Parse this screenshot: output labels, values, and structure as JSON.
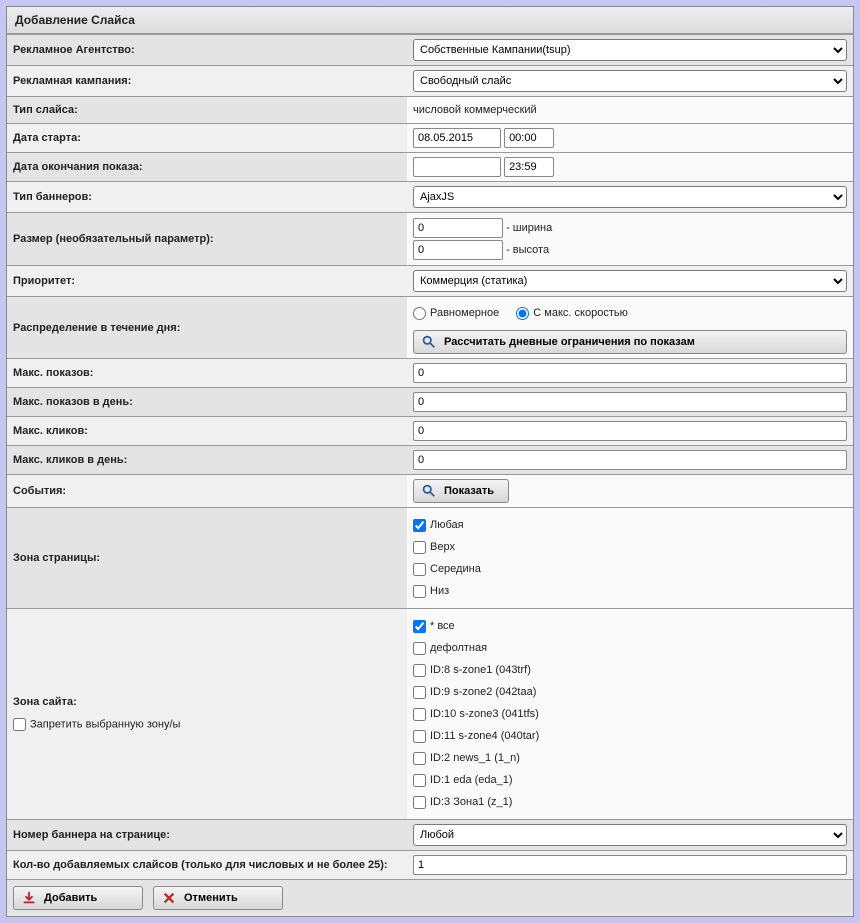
{
  "title": "Добавление Слайса",
  "rows": {
    "agency": {
      "label": "Рекламное Агентство:",
      "value": "Собственные Кампании(tsup)"
    },
    "campaign": {
      "label": "Рекламная кампания:",
      "value": "Свободный слайс"
    },
    "sliceType": {
      "label": "Тип слайса:",
      "value": "числовой коммерческий"
    },
    "startDate": {
      "label": "Дата старта:",
      "date": "08.05.2015",
      "time": "00:00"
    },
    "endDate": {
      "label": "Дата окончания показа:",
      "date": "",
      "time": "23:59"
    },
    "bannerType": {
      "label": "Тип баннеров:",
      "value": "AjaxJS"
    },
    "size": {
      "label": "Размер (необязательный параметр):",
      "width": "0",
      "widthLabel": " - ширина",
      "height": "0",
      "heightLabel": " - высота"
    },
    "priority": {
      "label": "Приоритет:",
      "value": "Коммерция (статика)"
    },
    "distribution": {
      "label": "Распределение в течение дня:",
      "opt1": "Равномерное",
      "opt2": "С макс. скоростью",
      "calcBtn": "Рассчитать дневные ограничения по показам"
    },
    "maxImp": {
      "label": "Макс. показов:",
      "value": "0"
    },
    "maxImpDay": {
      "label": "Макс. показов в день:",
      "value": "0"
    },
    "maxClk": {
      "label": "Макс. кликов:",
      "value": "0"
    },
    "maxClkDay": {
      "label": "Макс. кликов в день:",
      "value": "0"
    },
    "events": {
      "label": "События:",
      "btn": "Показать"
    },
    "pageZone": {
      "label": "Зона страницы:",
      "opts": [
        "Любая",
        "Верх",
        "Середина",
        "Низ"
      ]
    },
    "siteZone": {
      "label": "Зона сайта:",
      "deny": "Запретить выбранную зону/ы",
      "opts": [
        "* все",
        "дефолтная",
        "ID:8 s-zone1 (043trf)",
        "ID:9 s-zone2 (042taa)",
        "ID:10 s-zone3 (041tfs)",
        "ID:11 s-zone4 (040tar)",
        "ID:2 news_1 (1_n)",
        "ID:1 eda (eda_1)",
        "ID:3 Зона1 (z_1)"
      ]
    },
    "bannerNum": {
      "label": "Номер баннера на странице:",
      "value": "Любой"
    },
    "count": {
      "label": "Кол-во добавляемых слайсов (только для числовых и не более 25):",
      "value": "1"
    }
  },
  "footer": {
    "add": "Добавить",
    "cancel": "Отменить"
  }
}
